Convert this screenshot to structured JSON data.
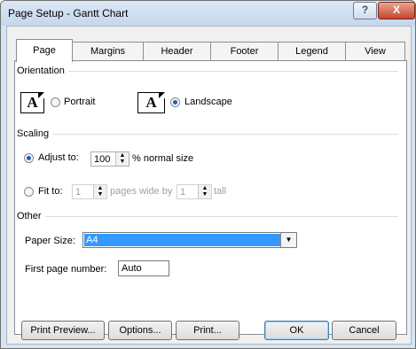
{
  "window": {
    "title": "Page Setup - Gantt Chart",
    "help_label": "?",
    "close_label": "X"
  },
  "tabs": [
    "Page",
    "Margins",
    "Header",
    "Footer",
    "Legend",
    "View"
  ],
  "orientation": {
    "heading": "Orientation",
    "portrait_label": "Portrait",
    "landscape_label": "Landscape",
    "icon_glyph": "A",
    "selected": "Landscape"
  },
  "scaling": {
    "heading": "Scaling",
    "adjust_label": "Adjust to:",
    "adjust_value": "100",
    "adjust_suffix": "% normal size",
    "fit_label": "Fit to:",
    "fit_pages_wide": "1",
    "fit_mid_label": "pages wide by",
    "fit_pages_tall": "1",
    "fit_tall_label": "tall",
    "selected": "Adjust to"
  },
  "other": {
    "heading": "Other",
    "paper_size_label": "Paper Size:",
    "paper_size_value": "A4",
    "first_page_label": "First page number:",
    "first_page_value": "Auto"
  },
  "buttons": {
    "print_preview": "Print Preview...",
    "options": "Options...",
    "print": "Print...",
    "ok": "OK",
    "cancel": "Cancel"
  },
  "colors": {
    "accent": "#3399ff",
    "titlebar": "#c5d7ed",
    "close": "#c7452d"
  }
}
